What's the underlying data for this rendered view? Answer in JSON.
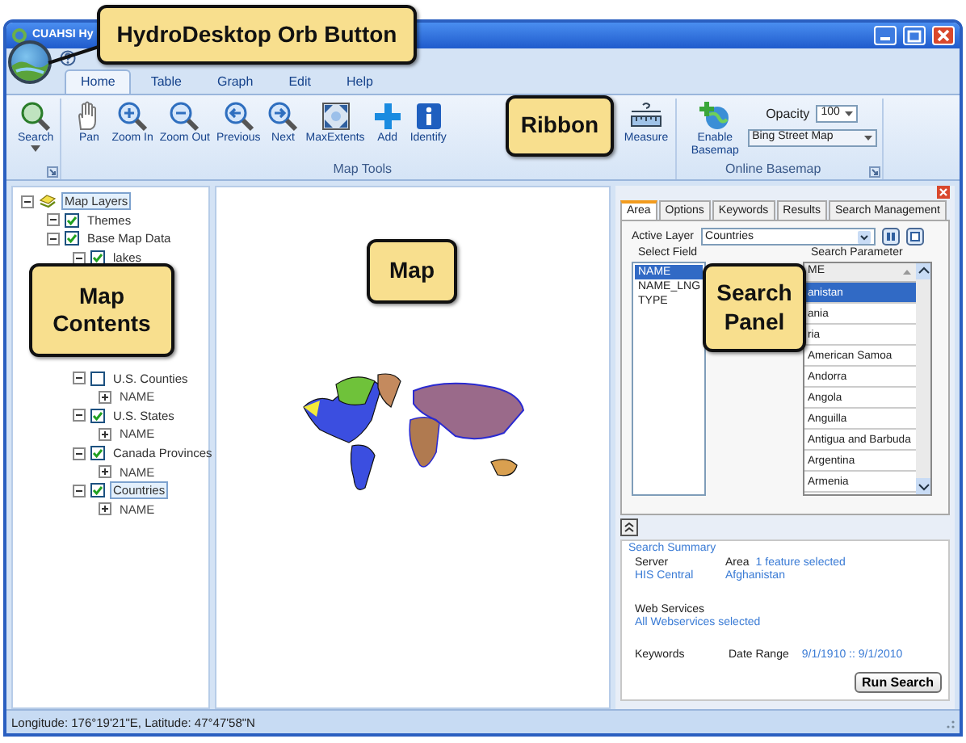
{
  "window": {
    "title": "CUAHSI Hy"
  },
  "callouts": [
    {
      "text": "HydroDesktop Orb Button"
    },
    {
      "text": "Ribbon"
    },
    {
      "text": "Map Contents"
    },
    {
      "text": "Map"
    },
    {
      "text": "Search Panel"
    }
  ],
  "ribbon": {
    "tabs": [
      {
        "label": "Home",
        "selected": true
      },
      {
        "label": "Table",
        "selected": false
      },
      {
        "label": "Graph",
        "selected": false
      },
      {
        "label": "Edit",
        "selected": false
      },
      {
        "label": "Help",
        "selected": false
      }
    ],
    "groups": [
      {
        "kind": "tools",
        "launcher": true,
        "buttons": [
          {
            "label": "Search",
            "dropdown": true
          }
        ]
      },
      {
        "kind": "tools",
        "label": "Map Tools",
        "launcher": false,
        "buttons": [
          {
            "label": "Pan"
          },
          {
            "label": "Zoom In"
          },
          {
            "label": "Zoom Out"
          },
          {
            "label": "Previous"
          },
          {
            "label": "Next"
          },
          {
            "label": "MaxExtents"
          },
          {
            "label": "Add"
          },
          {
            "label": "Identify"
          },
          {
            "label": "Measure"
          }
        ]
      },
      {
        "kind": "basemap",
        "label": "Online Basemap",
        "launcher": true,
        "button": "Enable Basemap",
        "opacity_label": "Opacity",
        "opacity": "100",
        "basemap": "Bing Street Map"
      }
    ]
  },
  "map_contents": {
    "items": [
      {
        "kind": "root",
        "label": "Map Layers",
        "expanded": true,
        "selected": true,
        "children": [
          {
            "kind": "layer",
            "label": "Themes",
            "expanded": true,
            "checked": true,
            "selected": false
          },
          {
            "kind": "layer",
            "label": "Base Map Data",
            "expanded": true,
            "checked": true,
            "selected": false,
            "children": [
              {
                "kind": "layer",
                "label": "lakes",
                "expanded": true,
                "checked": true,
                "selected": false
              },
              {
                "kind": "layer",
                "label": "U.S. Counties",
                "expanded": true,
                "checked": false,
                "selected": false,
                "children": [
                  {
                    "kind": "field",
                    "label": "NAME",
                    "expanded": false,
                    "selected": false
                  }
                ]
              },
              {
                "kind": "layer",
                "label": "U.S. States",
                "expanded": true,
                "checked": true,
                "selected": false,
                "children": [
                  {
                    "kind": "field",
                    "label": "NAME",
                    "expanded": false,
                    "selected": false
                  }
                ]
              },
              {
                "kind": "layer",
                "label": "Canada Provinces",
                "expanded": true,
                "checked": true,
                "selected": false,
                "children": [
                  {
                    "kind": "field",
                    "label": "NAME",
                    "expanded": false,
                    "selected": false
                  }
                ]
              },
              {
                "kind": "layer",
                "label": "Countries",
                "expanded": true,
                "checked": true,
                "selected": true,
                "children": [
                  {
                    "kind": "field",
                    "label": "NAME",
                    "expanded": false,
                    "selected": false
                  }
                ]
              }
            ]
          }
        ]
      }
    ]
  },
  "search_panel": {
    "tabs": [
      {
        "label": "Area",
        "selected": true
      },
      {
        "label": "Options",
        "selected": false
      },
      {
        "label": "Keywords",
        "selected": false
      },
      {
        "label": "Results",
        "selected": false
      },
      {
        "label": "Search Management",
        "selected": false
      }
    ],
    "active_layer_label": "Active Layer",
    "active_layer": "Countries",
    "select_field_label": "Select Field",
    "fields": [
      {
        "label": "NAME",
        "selected": true
      },
      {
        "label": "NAME_LNG",
        "selected": false
      },
      {
        "label": "TYPE",
        "selected": false
      }
    ],
    "search_parameter_label": "Search Parameter",
    "column": "ME",
    "rows": [
      {
        "label": "anistan",
        "selected": true
      },
      {
        "label": "ania",
        "selected": false
      },
      {
        "label": "ria",
        "selected": false
      },
      {
        "label": "American Samoa",
        "selected": false
      },
      {
        "label": "Andorra",
        "selected": false
      },
      {
        "label": "Angola",
        "selected": false
      },
      {
        "label": "Anguilla",
        "selected": false
      },
      {
        "label": "Antigua and Barbuda",
        "selected": false
      },
      {
        "label": "Argentina",
        "selected": false
      },
      {
        "label": "Armenia",
        "selected": false
      }
    ],
    "summary": {
      "title": "Search Summary",
      "server_label": "Server",
      "server": "HIS Central",
      "area_label": "Area",
      "area_count": "1 feature selected",
      "area": "Afghanistan",
      "web_services_label": "Web Services",
      "web_services": "All Webservices selected",
      "keywords_label": "Keywords",
      "date_range_label": "Date Range",
      "date_range": "9/1/1910 :: 9/1/2010"
    },
    "run_button": "Run Search"
  },
  "status_bar": "Longitude: 176°19'21\"E, Latitude: 47°47'58\"N"
}
